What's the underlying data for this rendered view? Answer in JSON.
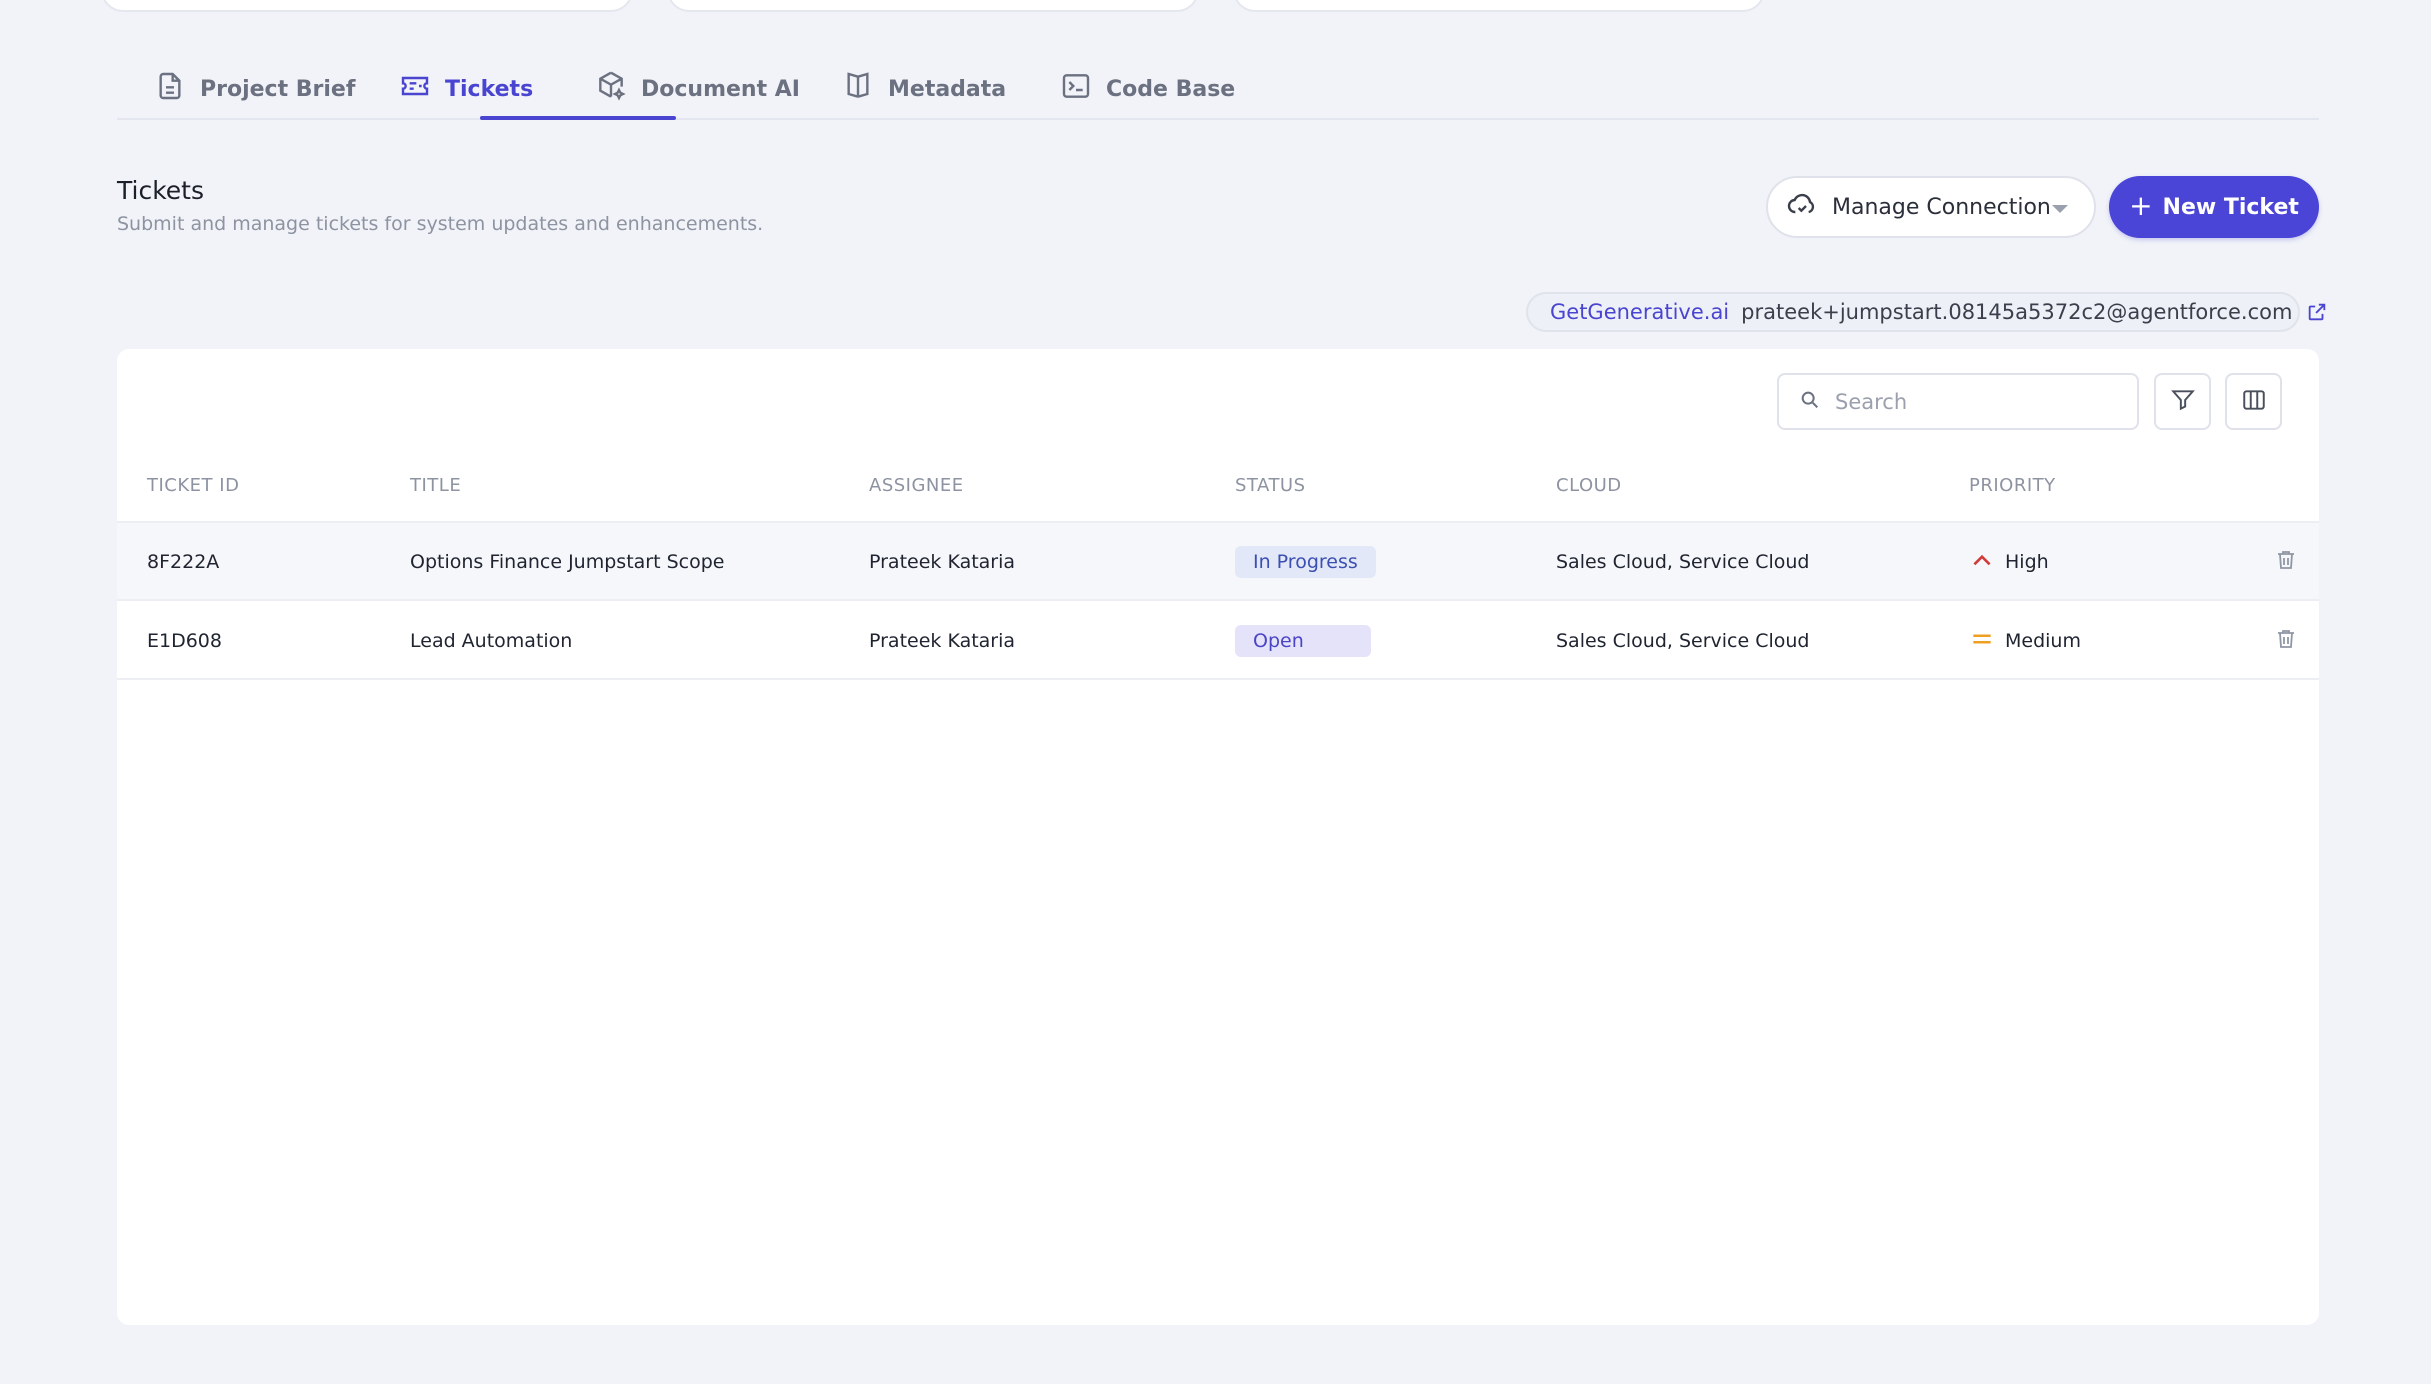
{
  "tabs": [
    {
      "label": "Project Brief",
      "icon": "document-icon"
    },
    {
      "label": "Tickets",
      "icon": "ticket-icon",
      "active": true
    },
    {
      "label": "Document AI",
      "icon": "cube-sparkle-icon"
    },
    {
      "label": "Metadata",
      "icon": "book-open-icon"
    },
    {
      "label": "Code Base",
      "icon": "terminal-icon"
    }
  ],
  "header": {
    "title": "Tickets",
    "subtitle": "Submit and manage tickets for system updates and enhancements."
  },
  "actions": {
    "manage_connection_label": "Manage Connection",
    "new_ticket_label": "New Ticket"
  },
  "connection": {
    "brand": "GetGenerative.ai",
    "email": "prateek+jumpstart.08145a5372c2@agentforce.com"
  },
  "table": {
    "search_placeholder": "Search",
    "columns": [
      "TICKET ID",
      "TITLE",
      "ASSIGNEE",
      "STATUS",
      "CLOUD",
      "PRIORITY"
    ],
    "rows": [
      {
        "id": "8F222A",
        "title": "Options Finance Jumpstart Scope",
        "assignee": "Prateek Kataria",
        "status": "In Progress",
        "cloud": "Sales Cloud, Service Cloud",
        "priority": "High"
      },
      {
        "id": "E1D608",
        "title": "Lead Automation",
        "assignee": "Prateek Kataria",
        "status": "Open",
        "cloud": "Sales Cloud, Service Cloud",
        "priority": "Medium"
      }
    ]
  },
  "colors": {
    "accent": "#4a45d6",
    "background": "#f1f3f8",
    "priority_high": "#d23a3a",
    "priority_medium": "#f0a020"
  }
}
